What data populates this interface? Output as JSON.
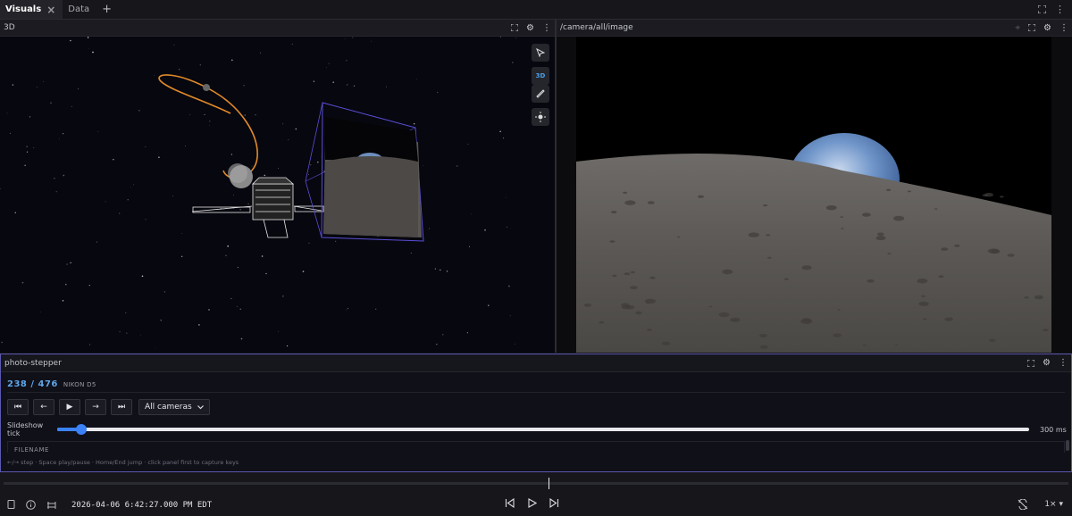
{
  "tabs": [
    {
      "label": "Visuals",
      "active": true
    },
    {
      "label": "Data",
      "active": false
    }
  ],
  "panels": {
    "three_d": {
      "title": "3D",
      "mode_label": "3D"
    },
    "image": {
      "title": "/camera/all/image"
    },
    "stepper": {
      "title": "photo-stepper",
      "counter": "238 / 476",
      "camera": "NIKON D5",
      "camera_select": "All cameras",
      "slider_label": "Slideshow tick",
      "slider_value": "300 ms",
      "slider_fraction": 0.025,
      "table_header": "FILENAME",
      "hint": "←/→ step · Space play/pause · Home/End jump · click panel first to capture keys",
      "buttons": [
        "⏮",
        "←",
        "▶",
        "→",
        "⏭"
      ]
    }
  },
  "playback": {
    "timestamp": "2026-04-06 6:42:27.000 PM EDT",
    "speed": "1×",
    "timeline_fraction": 0.512
  },
  "colors": {
    "accent": "#3b82f6",
    "counter": "#5ea6e8",
    "stepper_border": "#5c59b0",
    "trajectory": "#e08a2a"
  },
  "icons": [
    "close-icon",
    "plus-icon",
    "fullscreen-icon",
    "more-icon",
    "gear-icon",
    "cursor-icon",
    "ruler-icon",
    "orbit-icon",
    "crosshair-icon",
    "info-icon",
    "playhead-icon",
    "loop-icon",
    "skip-back-icon",
    "play-icon",
    "skip-forward-icon",
    "sync-off-icon",
    "caret-down-icon"
  ]
}
